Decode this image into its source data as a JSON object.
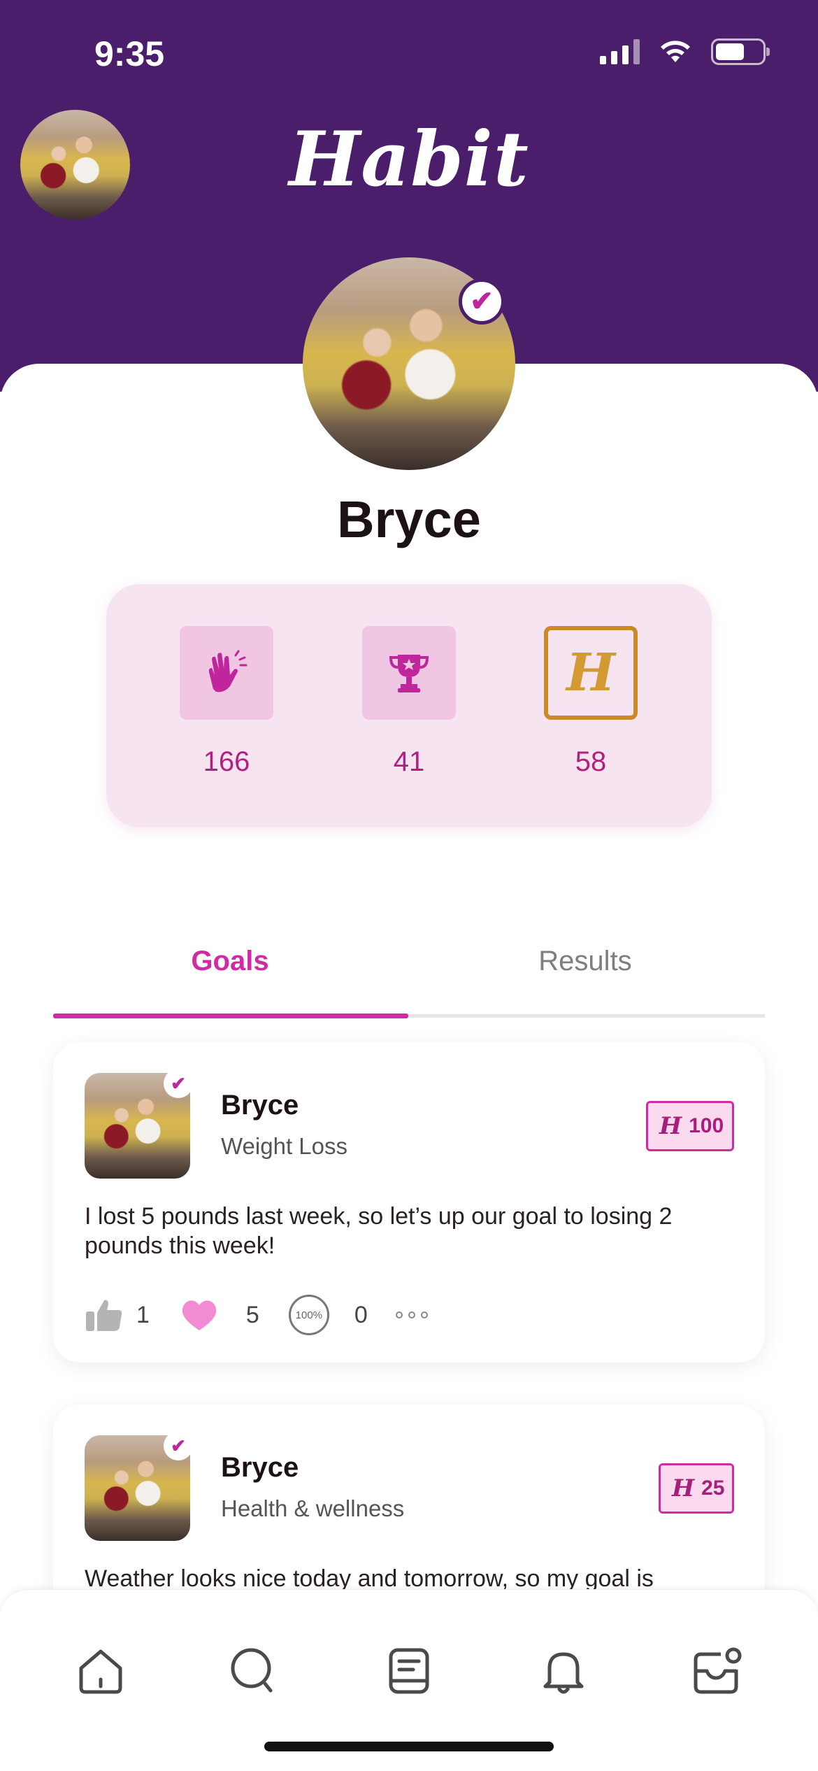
{
  "status_bar": {
    "time": "9:35"
  },
  "header": {
    "app_title": "Habit"
  },
  "profile": {
    "name": "Bryce"
  },
  "stats": [
    {
      "icon": "clap-icon",
      "value": "166"
    },
    {
      "icon": "trophy-icon",
      "value": "41"
    },
    {
      "icon": "habit-coin-icon",
      "value": "58"
    }
  ],
  "tabs": [
    {
      "label": "Goals",
      "active": true
    },
    {
      "label": "Results",
      "active": false
    }
  ],
  "posts": [
    {
      "author": "Bryce",
      "category": "Weight Loss",
      "badge_value": "100",
      "text": "I lost 5 pounds last week, so let’s up our goal to losing 2 pounds this week!",
      "likes": "1",
      "hearts": "5",
      "percent_label": "100%",
      "percent_count": "0"
    },
    {
      "author": "Bryce",
      "category": "Health & wellness",
      "badge_value": "25",
      "text": "Weather looks nice today and tomorrow, so my goal is"
    }
  ],
  "badge_symbol": "H",
  "colors": {
    "header": "#4a1e6a",
    "accent": "#d12ba4",
    "stats_bg": "#f7e4f1",
    "gold": "#c98a2a"
  },
  "bottom_nav": [
    "home-icon",
    "search-icon",
    "journal-icon",
    "bell-icon",
    "inbox-icon"
  ]
}
